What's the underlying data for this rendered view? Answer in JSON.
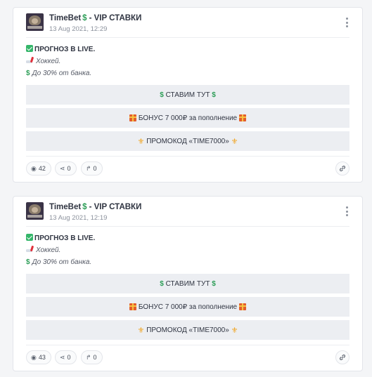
{
  "posts": [
    {
      "channel": "TimeBet",
      "channel_suffix": "- VIP СТАВКИ",
      "date": "13 Aug 2021, 12:29",
      "line1": "ПРОГНОЗ В LIVE.",
      "line2": "Хоккей.",
      "line3": "До 30% от банка.",
      "button1": "СТАВИМ ТУТ",
      "button2": "БОНУС 7 000₽ за пополнение",
      "button3": "ПРОМОКОД «TIME7000»",
      "views": "42",
      "shares": "0",
      "forwards": "0"
    },
    {
      "channel": "TimeBet",
      "channel_suffix": "- VIP СТАВКИ",
      "date": "13 Aug 2021, 12:19",
      "line1": "ПРОГНОЗ В LIVE.",
      "line2": "Хоккей.",
      "line3": "До 30% от банка.",
      "button1": "СТАВИМ ТУТ",
      "button2": "БОНУС 7 000₽ за пополнение",
      "button3": "ПРОМОКОД «TIME7000»",
      "views": "43",
      "shares": "0",
      "forwards": "0"
    }
  ],
  "icons": {
    "dollar": "$",
    "fleur": "⚜",
    "eye": "👁",
    "share": "⎇",
    "forward": "↱",
    "link": "🔗"
  },
  "colors": {
    "accent_green": "#2e9e58",
    "check_green": "#35b66a",
    "button_bg": "#eceef2"
  }
}
